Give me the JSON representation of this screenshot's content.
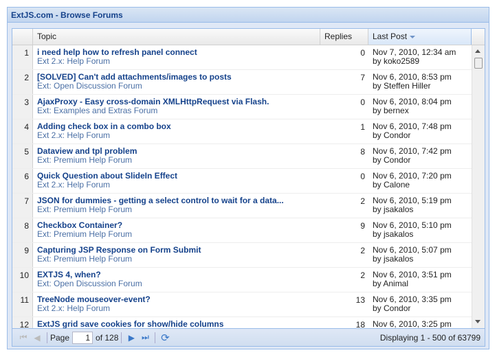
{
  "title": "ExtJS.com - Browse Forums",
  "columns": {
    "topic": "Topic",
    "replies": "Replies",
    "last_post": "Last Post"
  },
  "rows": [
    {
      "n": "1",
      "title": "i need help how to refresh panel connect",
      "forum": "Ext 2.x: Help Forum",
      "replies": "0",
      "date": "Nov 7, 2010, 12:34 am",
      "by": "by koko2589"
    },
    {
      "n": "2",
      "title": "[SOLVED] Can't add attachments/images to posts",
      "forum": "Ext: Open Discussion Forum",
      "replies": "7",
      "date": "Nov 6, 2010, 8:53 pm",
      "by": "by Steffen Hiller"
    },
    {
      "n": "3",
      "title": "AjaxProxy - Easy cross-domain XMLHttpRequest via Flash.",
      "forum": "Ext: Examples and Extras Forum",
      "replies": "0",
      "date": "Nov 6, 2010, 8:04 pm",
      "by": "by bernex"
    },
    {
      "n": "4",
      "title": "Adding check box in a combo box",
      "forum": "Ext 2.x: Help Forum",
      "replies": "1",
      "date": "Nov 6, 2010, 7:48 pm",
      "by": "by Condor"
    },
    {
      "n": "5",
      "title": "Dataview and tpl problem",
      "forum": "Ext: Premium Help Forum",
      "replies": "8",
      "date": "Nov 6, 2010, 7:42 pm",
      "by": "by Condor"
    },
    {
      "n": "6",
      "title": "Quick Question about SlideIn Effect",
      "forum": "Ext 2.x: Help Forum",
      "replies": "0",
      "date": "Nov 6, 2010, 7:20 pm",
      "by": "by Calone"
    },
    {
      "n": "7",
      "title": "JSON for dummies - getting a select control to wait for a data...",
      "forum": "Ext: Premium Help Forum",
      "replies": "2",
      "date": "Nov 6, 2010, 5:19 pm",
      "by": "by jsakalos"
    },
    {
      "n": "8",
      "title": "Checkbox Container?",
      "forum": "Ext: Premium Help Forum",
      "replies": "9",
      "date": "Nov 6, 2010, 5:10 pm",
      "by": "by jsakalos"
    },
    {
      "n": "9",
      "title": "Capturing JSP Response on Form Submit",
      "forum": "Ext: Premium Help Forum",
      "replies": "2",
      "date": "Nov 6, 2010, 5:07 pm",
      "by": "by jsakalos"
    },
    {
      "n": "10",
      "title": "EXTJS 4, when?",
      "forum": "Ext: Open Discussion Forum",
      "replies": "2",
      "date": "Nov 6, 2010, 3:51 pm",
      "by": "by Animal"
    },
    {
      "n": "11",
      "title": "TreeNode mouseover-event?",
      "forum": "Ext 2.x: Help Forum",
      "replies": "13",
      "date": "Nov 6, 2010, 3:35 pm",
      "by": "by Condor"
    },
    {
      "n": "12",
      "title": "ExtJS grid save cookies for show/hide columns",
      "forum": "",
      "replies": "18",
      "date": "Nov 6, 2010, 3:25 pm",
      "by": ""
    }
  ],
  "paging": {
    "page_label": "Page",
    "page_value": "1",
    "of_label": "of 128",
    "display_prefix": "Displaying ",
    "display_range": "1 - 500",
    "display_suffix": " of 63799"
  },
  "colors": {
    "accent": "#15428b",
    "border": "#99bbe8"
  }
}
